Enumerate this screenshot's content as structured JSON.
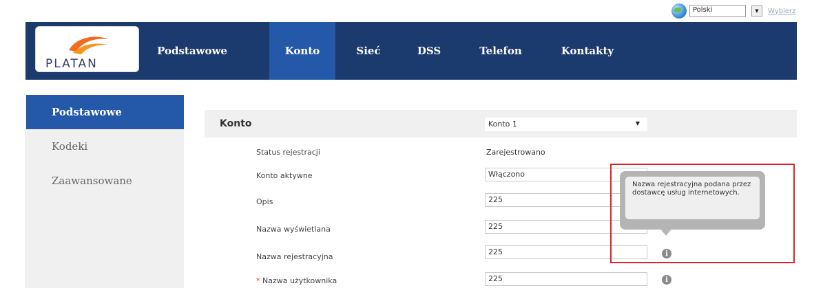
{
  "language_bar": {
    "selected_language": "Polski",
    "select_link": "Wybierz",
    "globe_icon": "globe-icon",
    "dropdown_icon": "triangle-down"
  },
  "header": {
    "logo_text": "PLATAN",
    "nav": [
      {
        "label": "Podstawowe",
        "active": false
      },
      {
        "label": "Konto",
        "active": true
      },
      {
        "label": "Sieć",
        "active": false
      },
      {
        "label": "DSS",
        "active": false
      },
      {
        "label": "Telefon",
        "active": false
      },
      {
        "label": "Kontakty",
        "active": false
      }
    ]
  },
  "sidebar": {
    "items": [
      {
        "label": "Podstawowe",
        "active": true
      },
      {
        "label": "Kodeki",
        "active": false
      },
      {
        "label": "Zaawansowane",
        "active": false
      }
    ]
  },
  "form": {
    "section_title": "Konto",
    "account_select": "Konto 1",
    "rows": [
      {
        "label": "Status rejestracji",
        "value": "Zarejestrowano"
      },
      {
        "label": "Konto aktywne",
        "value": "Włączono"
      },
      {
        "label": "Opis",
        "value": "225"
      },
      {
        "label": "Nazwa wyświetlana",
        "value": "225"
      },
      {
        "label": "Nazwa rejestracyjna",
        "value": "225"
      },
      {
        "label": "Nazwa użytkownika",
        "value": "225",
        "required_mark": "*"
      }
    ]
  },
  "tooltip": {
    "text": "Nazwa rejestracyjna podana przez dostawcę usług internetowych."
  },
  "colors": {
    "header_bg": "#1b3a6d",
    "active_nav_bg": "#2359a8",
    "sidebar_bg": "#f0f0f0",
    "highlight": "#e0222a",
    "logo_orange": "#f26b21"
  }
}
